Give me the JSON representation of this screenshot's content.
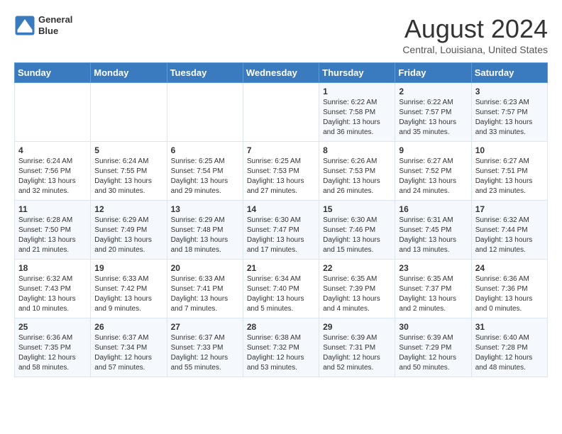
{
  "header": {
    "logo_line1": "General",
    "logo_line2": "Blue",
    "month_year": "August 2024",
    "location": "Central, Louisiana, United States"
  },
  "weekdays": [
    "Sunday",
    "Monday",
    "Tuesday",
    "Wednesday",
    "Thursday",
    "Friday",
    "Saturday"
  ],
  "weeks": [
    [
      {
        "day": "",
        "info": ""
      },
      {
        "day": "",
        "info": ""
      },
      {
        "day": "",
        "info": ""
      },
      {
        "day": "",
        "info": ""
      },
      {
        "day": "1",
        "info": "Sunrise: 6:22 AM\nSunset: 7:58 PM\nDaylight: 13 hours\nand 36 minutes."
      },
      {
        "day": "2",
        "info": "Sunrise: 6:22 AM\nSunset: 7:57 PM\nDaylight: 13 hours\nand 35 minutes."
      },
      {
        "day": "3",
        "info": "Sunrise: 6:23 AM\nSunset: 7:57 PM\nDaylight: 13 hours\nand 33 minutes."
      }
    ],
    [
      {
        "day": "4",
        "info": "Sunrise: 6:24 AM\nSunset: 7:56 PM\nDaylight: 13 hours\nand 32 minutes."
      },
      {
        "day": "5",
        "info": "Sunrise: 6:24 AM\nSunset: 7:55 PM\nDaylight: 13 hours\nand 30 minutes."
      },
      {
        "day": "6",
        "info": "Sunrise: 6:25 AM\nSunset: 7:54 PM\nDaylight: 13 hours\nand 29 minutes."
      },
      {
        "day": "7",
        "info": "Sunrise: 6:25 AM\nSunset: 7:53 PM\nDaylight: 13 hours\nand 27 minutes."
      },
      {
        "day": "8",
        "info": "Sunrise: 6:26 AM\nSunset: 7:53 PM\nDaylight: 13 hours\nand 26 minutes."
      },
      {
        "day": "9",
        "info": "Sunrise: 6:27 AM\nSunset: 7:52 PM\nDaylight: 13 hours\nand 24 minutes."
      },
      {
        "day": "10",
        "info": "Sunrise: 6:27 AM\nSunset: 7:51 PM\nDaylight: 13 hours\nand 23 minutes."
      }
    ],
    [
      {
        "day": "11",
        "info": "Sunrise: 6:28 AM\nSunset: 7:50 PM\nDaylight: 13 hours\nand 21 minutes."
      },
      {
        "day": "12",
        "info": "Sunrise: 6:29 AM\nSunset: 7:49 PM\nDaylight: 13 hours\nand 20 minutes."
      },
      {
        "day": "13",
        "info": "Sunrise: 6:29 AM\nSunset: 7:48 PM\nDaylight: 13 hours\nand 18 minutes."
      },
      {
        "day": "14",
        "info": "Sunrise: 6:30 AM\nSunset: 7:47 PM\nDaylight: 13 hours\nand 17 minutes."
      },
      {
        "day": "15",
        "info": "Sunrise: 6:30 AM\nSunset: 7:46 PM\nDaylight: 13 hours\nand 15 minutes."
      },
      {
        "day": "16",
        "info": "Sunrise: 6:31 AM\nSunset: 7:45 PM\nDaylight: 13 hours\nand 13 minutes."
      },
      {
        "day": "17",
        "info": "Sunrise: 6:32 AM\nSunset: 7:44 PM\nDaylight: 13 hours\nand 12 minutes."
      }
    ],
    [
      {
        "day": "18",
        "info": "Sunrise: 6:32 AM\nSunset: 7:43 PM\nDaylight: 13 hours\nand 10 minutes."
      },
      {
        "day": "19",
        "info": "Sunrise: 6:33 AM\nSunset: 7:42 PM\nDaylight: 13 hours\nand 9 minutes."
      },
      {
        "day": "20",
        "info": "Sunrise: 6:33 AM\nSunset: 7:41 PM\nDaylight: 13 hours\nand 7 minutes."
      },
      {
        "day": "21",
        "info": "Sunrise: 6:34 AM\nSunset: 7:40 PM\nDaylight: 13 hours\nand 5 minutes."
      },
      {
        "day": "22",
        "info": "Sunrise: 6:35 AM\nSunset: 7:39 PM\nDaylight: 13 hours\nand 4 minutes."
      },
      {
        "day": "23",
        "info": "Sunrise: 6:35 AM\nSunset: 7:37 PM\nDaylight: 13 hours\nand 2 minutes."
      },
      {
        "day": "24",
        "info": "Sunrise: 6:36 AM\nSunset: 7:36 PM\nDaylight: 13 hours\nand 0 minutes."
      }
    ],
    [
      {
        "day": "25",
        "info": "Sunrise: 6:36 AM\nSunset: 7:35 PM\nDaylight: 12 hours\nand 58 minutes."
      },
      {
        "day": "26",
        "info": "Sunrise: 6:37 AM\nSunset: 7:34 PM\nDaylight: 12 hours\nand 57 minutes."
      },
      {
        "day": "27",
        "info": "Sunrise: 6:37 AM\nSunset: 7:33 PM\nDaylight: 12 hours\nand 55 minutes."
      },
      {
        "day": "28",
        "info": "Sunrise: 6:38 AM\nSunset: 7:32 PM\nDaylight: 12 hours\nand 53 minutes."
      },
      {
        "day": "29",
        "info": "Sunrise: 6:39 AM\nSunset: 7:31 PM\nDaylight: 12 hours\nand 52 minutes."
      },
      {
        "day": "30",
        "info": "Sunrise: 6:39 AM\nSunset: 7:29 PM\nDaylight: 12 hours\nand 50 minutes."
      },
      {
        "day": "31",
        "info": "Sunrise: 6:40 AM\nSunset: 7:28 PM\nDaylight: 12 hours\nand 48 minutes."
      }
    ]
  ]
}
